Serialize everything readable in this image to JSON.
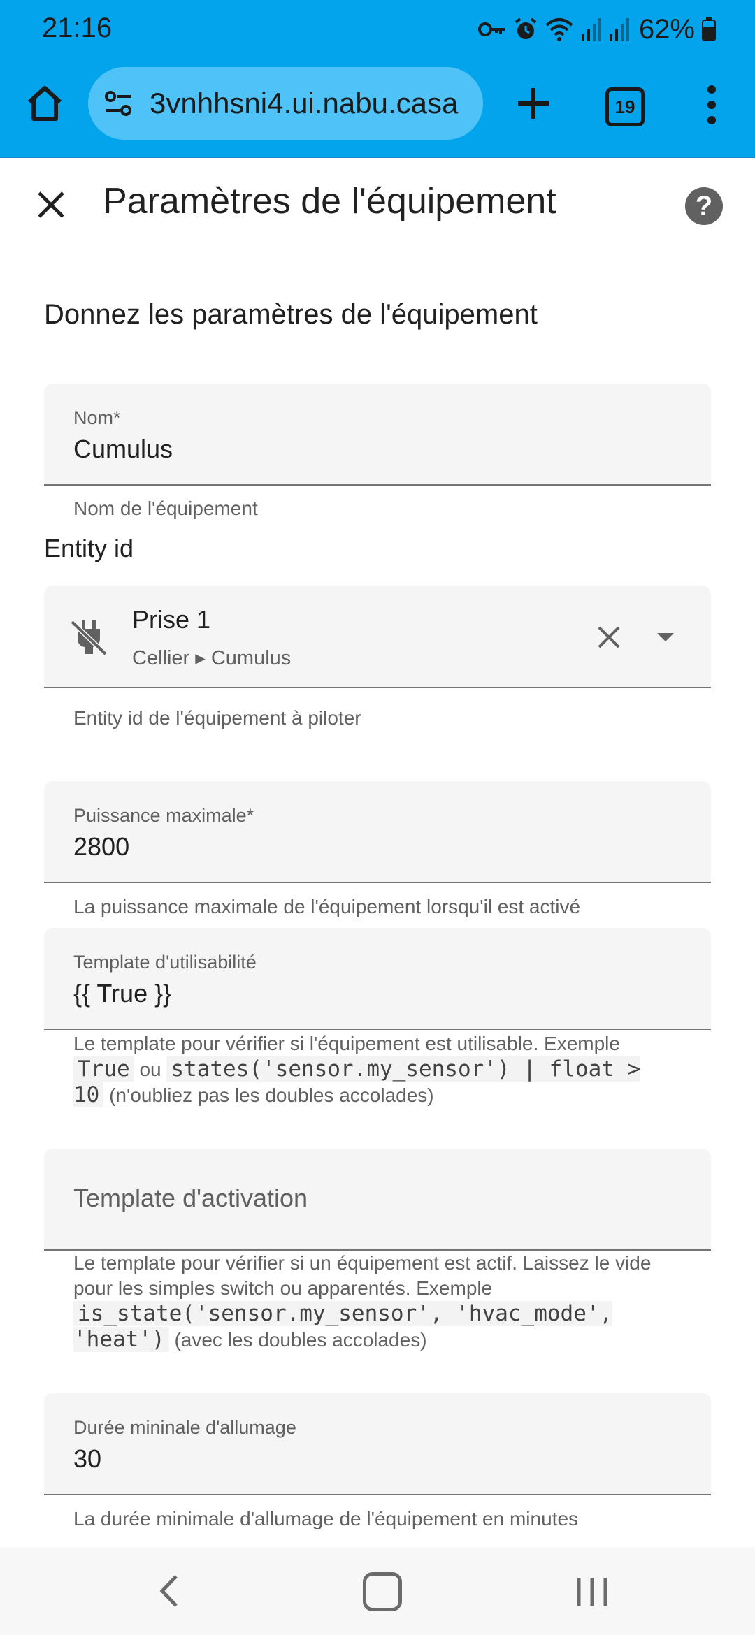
{
  "status_bar": {
    "time": "21:16",
    "battery": "62%",
    "icons": [
      "key-icon",
      "alarm-icon",
      "wifi-icon",
      "signal-icon",
      "signal-icon",
      "battery-icon"
    ]
  },
  "browser": {
    "url": "3vnhhsni4.ui.nabu.casa",
    "tab_count": "19"
  },
  "dialog": {
    "title": "Paramètres de l'équipement",
    "section_heading": "Donnez les paramètres de l'équipement"
  },
  "fields": {
    "nom": {
      "label": "Nom*",
      "value": "Cumulus",
      "helper": "Nom de l'équipement"
    },
    "entity": {
      "section_label": "Entity id",
      "name": "Prise 1",
      "area": "Cellier ▸ Cumulus",
      "helper": "Entity id de l'équipement à piloter"
    },
    "puissance": {
      "label": "Puissance maximale*",
      "value": "2800",
      "helper": "La puissance maximale de l'équipement lorsqu'il est activé"
    },
    "utilisabilite": {
      "label": "Template d'utilisabilité",
      "value": "{{ True }}",
      "helper_text": "Le template pour vérifier si l'équipement est utilisable. Exemple",
      "helper_code1": "True",
      "helper_or": "ou",
      "helper_code2": "states('sensor.my_sensor') | float > 10",
      "helper_note": "(n'oubliez pas les doubles accolades)"
    },
    "activation": {
      "placeholder": "Template d'activation",
      "helper_text": "Le template pour vérifier si un équipement est actif. Laissez le vide pour les simples switch ou apparentés. Exemple",
      "helper_code": "is_state('sensor.my_sensor', 'hvac_mode', 'heat')",
      "helper_note": "(avec les doubles accolades)"
    },
    "duree": {
      "label": "Durée mininale d'allumage",
      "value": "30",
      "helper": "La durée minimale d'allumage de l'équipement en minutes"
    }
  },
  "colors": {
    "browser_bar": "#03a4ec",
    "url_pill": "#4fc3f7",
    "field_bg": "#f5f5f5"
  }
}
